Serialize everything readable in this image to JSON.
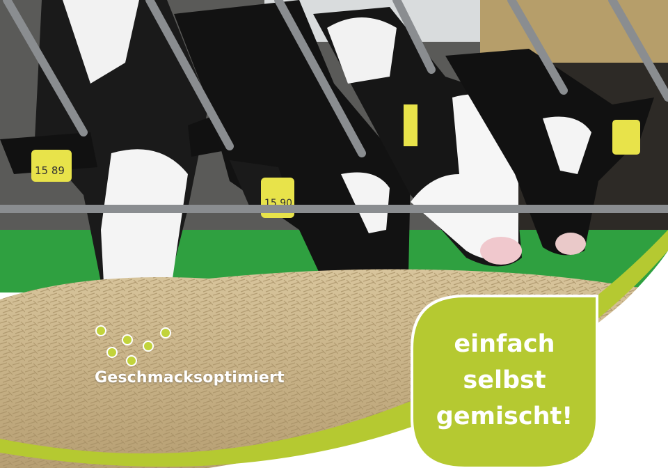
{
  "logo": {
    "text": "Geschmacksoptimiert",
    "icon": "dot-cluster-icon",
    "dot_color": "#c2d33b"
  },
  "slogan": {
    "lines": [
      "einfach",
      "selbst",
      "gemischt!"
    ]
  },
  "ear_tags": [
    "15 89",
    "15 90"
  ],
  "colors": {
    "accent": "#b5c931",
    "stable_floor": "#2fa040",
    "hay": "#c9b48a"
  }
}
